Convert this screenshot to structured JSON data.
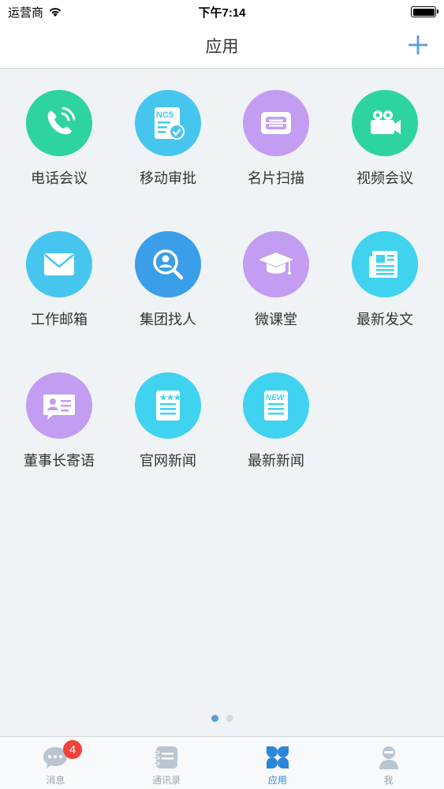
{
  "status_bar": {
    "carrier": "运营商",
    "time": "下午7:14",
    "icons": [
      "wifi-icon",
      "battery-icon"
    ]
  },
  "nav": {
    "title": "应用",
    "add_icon": "plus-icon"
  },
  "apps": [
    {
      "label": "电话会议",
      "icon": "phone-icon",
      "color": "#2ed4a0"
    },
    {
      "label": "移动审批",
      "icon": "nc5-approval-icon",
      "color": "#46c6ef"
    },
    {
      "label": "名片扫描",
      "icon": "card-scan-icon",
      "color": "#c39df2"
    },
    {
      "label": "视频会议",
      "icon": "video-camera-icon",
      "color": "#2ed4a0"
    },
    {
      "label": "工作邮箱",
      "icon": "mail-icon",
      "color": "#46c6ef"
    },
    {
      "label": "集团找人",
      "icon": "person-search-icon",
      "color": "#3a9ee8"
    },
    {
      "label": "微课堂",
      "icon": "graduation-cap-icon",
      "color": "#c39df2"
    },
    {
      "label": "最新发文",
      "icon": "newspaper-icon",
      "color": "#3fd3f0"
    },
    {
      "label": "董事长寄语",
      "icon": "id-card-icon",
      "color": "#c39df2"
    },
    {
      "label": "官网新闻",
      "icon": "news-list-icon",
      "color": "#3fd3f0"
    },
    {
      "label": "最新新闻",
      "icon": "new-news-icon",
      "color": "#3fd3f0"
    }
  ],
  "pager": {
    "pages": 2,
    "active": 1
  },
  "tabs": [
    {
      "label": "消息",
      "icon": "chat-bubble-icon",
      "badge": "4",
      "active": false
    },
    {
      "label": "通讯录",
      "icon": "address-book-icon",
      "active": false
    },
    {
      "label": "应用",
      "icon": "apps-grid-icon",
      "active": true
    },
    {
      "label": "我",
      "icon": "user-icon",
      "active": false
    }
  ]
}
